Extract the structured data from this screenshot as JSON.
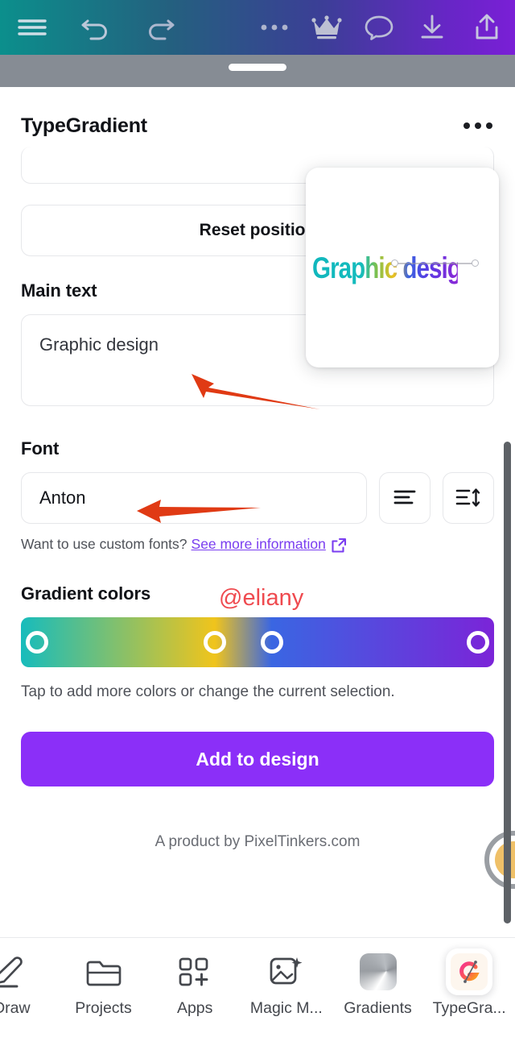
{
  "toolbar": {
    "items": [
      {
        "name": "menu-icon",
        "label": "Menu"
      },
      {
        "name": "undo-icon",
        "label": "Undo"
      },
      {
        "name": "redo-icon",
        "label": "Redo"
      },
      {
        "name": "more-options-icon",
        "label": "More options"
      },
      {
        "name": "crown-icon",
        "label": "Pro"
      },
      {
        "name": "comment-icon",
        "label": "Comments"
      },
      {
        "name": "download-icon",
        "label": "Download"
      },
      {
        "name": "share-icon",
        "label": "Share"
      }
    ]
  },
  "panel": {
    "title": "TypeGradient",
    "menu_label": "More",
    "reset_position_label": "Reset position",
    "main_text_label": "Main text",
    "main_text_value": "Graphic design",
    "font_label": "Font",
    "font_value": "Anton",
    "align_icon_label": "Text align left",
    "line_height_icon_label": "Line height",
    "custom_fonts_question": "Want to use custom fonts?",
    "custom_fonts_link": "See more information",
    "external_link_icon_label": "Opens in new window",
    "gradient_colors_label": "Gradient colors",
    "gradient_hint": "Tap to add more colors or change the current selection.",
    "cta_label": "Add to design",
    "footer_note": "A product by PixelTinkers.com"
  },
  "preview": {
    "text": "Graphic design"
  },
  "annotations": {
    "watermark": "@eliany",
    "arrow_color": "#e03a14",
    "watermark_color": "#ef4a4f"
  },
  "gradient": {
    "stops": [
      {
        "color": "#17bcbc",
        "position": 0
      },
      {
        "color": "#f0c41c",
        "position": 41
      },
      {
        "color": "#3a66e2",
        "position": 53
      },
      {
        "color": "#7b24d8",
        "position": 100
      }
    ],
    "handle_positions": [
      0,
      41,
      53,
      100
    ]
  },
  "colors": {
    "cta_purple": "#8b2ff8",
    "link_purple": "#7a3df0",
    "toolbar_start": "#0b8f8c",
    "toolbar_end": "#7a1fd6",
    "scrollbar": "#5d6166",
    "sheet_gray_strip": "#868c94"
  },
  "bottom_nav": {
    "items": [
      {
        "label": "Draw",
        "icon": "pen-draw-icon",
        "selected": false
      },
      {
        "label": "Projects",
        "icon": "folder-icon",
        "selected": false
      },
      {
        "label": "Apps",
        "icon": "apps-grid-plus-icon",
        "selected": false
      },
      {
        "label": "Magic M...",
        "icon": "magic-media-icon",
        "selected": false
      },
      {
        "label": "Gradients",
        "icon": "gradient-square-icon",
        "selected": false
      },
      {
        "label": "TypeGra...",
        "icon": "typegradient-app-icon",
        "selected": true
      }
    ]
  }
}
